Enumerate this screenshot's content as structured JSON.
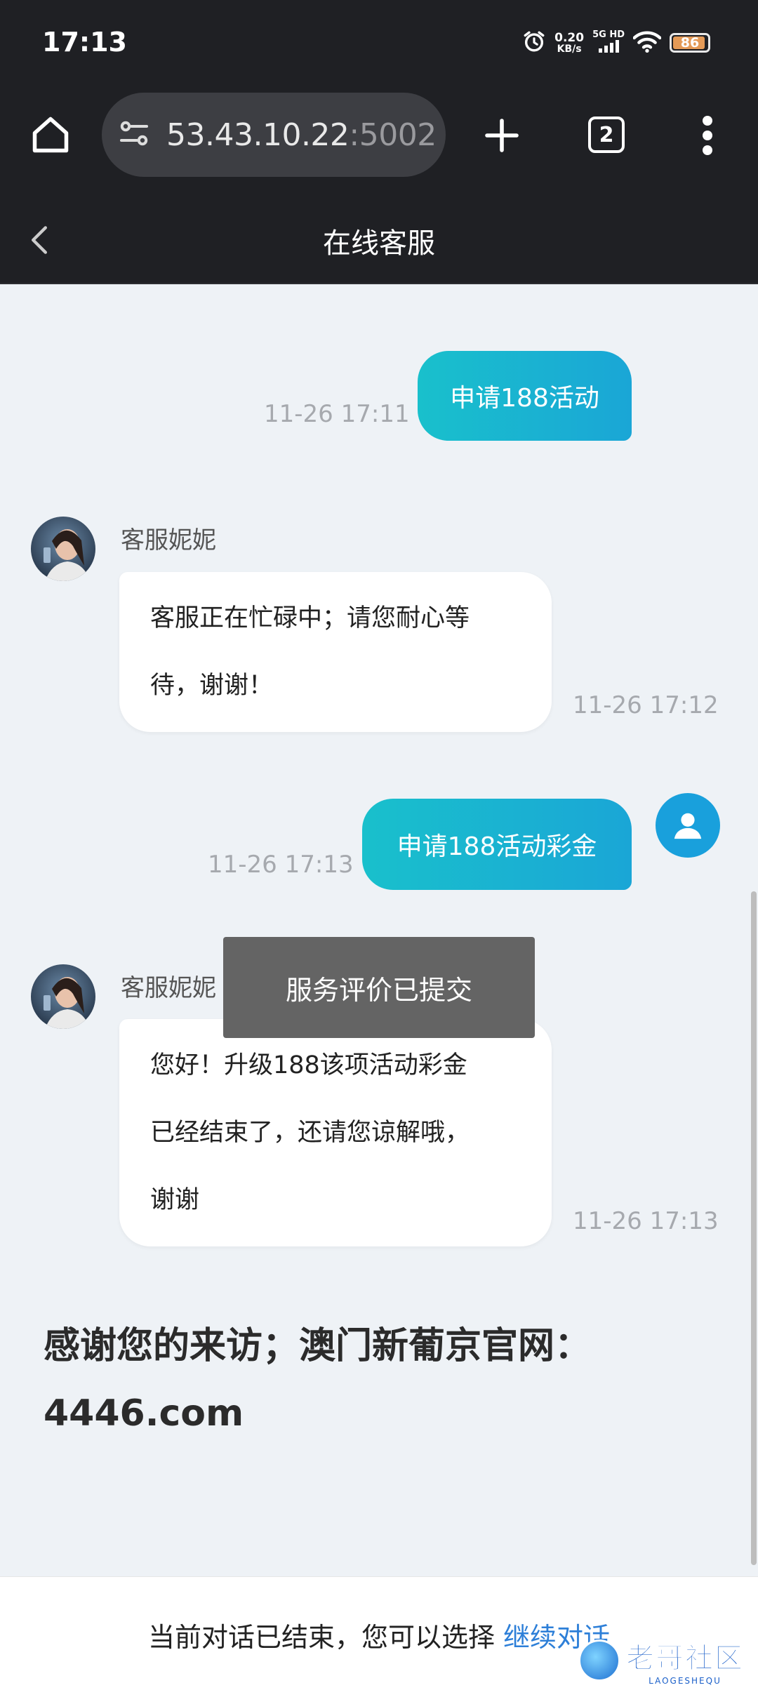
{
  "status_bar": {
    "time": "17:13",
    "net_speed_value": "0.20",
    "net_speed_unit": "KB/s",
    "net_type": "5G HD",
    "battery": "86",
    "battery_level": 0.86
  },
  "browser": {
    "url_host": "53.43.10.22",
    "url_port": ":5002",
    "tab_count": "2"
  },
  "chat": {
    "title": "在线客服",
    "messages": [
      {
        "type": "outgoing",
        "text": "申请188活动",
        "time": "11-26 17:11"
      },
      {
        "type": "incoming",
        "sender": "客服妮妮",
        "lines": [
          "客服正在忙碌中；请您耐心等",
          "待，谢谢！"
        ],
        "time": "11-26 17:12"
      },
      {
        "type": "outgoing",
        "text": "申请188活动彩金",
        "time": "11-26 17:13"
      },
      {
        "type": "incoming",
        "sender": "客服妮妮",
        "lines": [
          "您好！升级188该项活动彩金",
          "已经结束了，还请您谅解哦，",
          "谢谢"
        ],
        "time": "11-26 17:13"
      }
    ],
    "thanks_lines": [
      "感谢您的来访；澳门新葡京官网：",
      "4446.com"
    ]
  },
  "toast": "服务评价已提交",
  "bottom_bar": {
    "text": "当前对话已结束，您可以选择 ",
    "link": "继续对话"
  },
  "watermark": {
    "main": "老哥社区",
    "sub": "LAOGESHEQU"
  },
  "colors": {
    "outgoing_start": "#19c0cc",
    "outgoing_end": "#1aa6d6",
    "link": "#2d7fd8",
    "header_bg": "#1f2024",
    "page_bg": "#eef2f6"
  }
}
